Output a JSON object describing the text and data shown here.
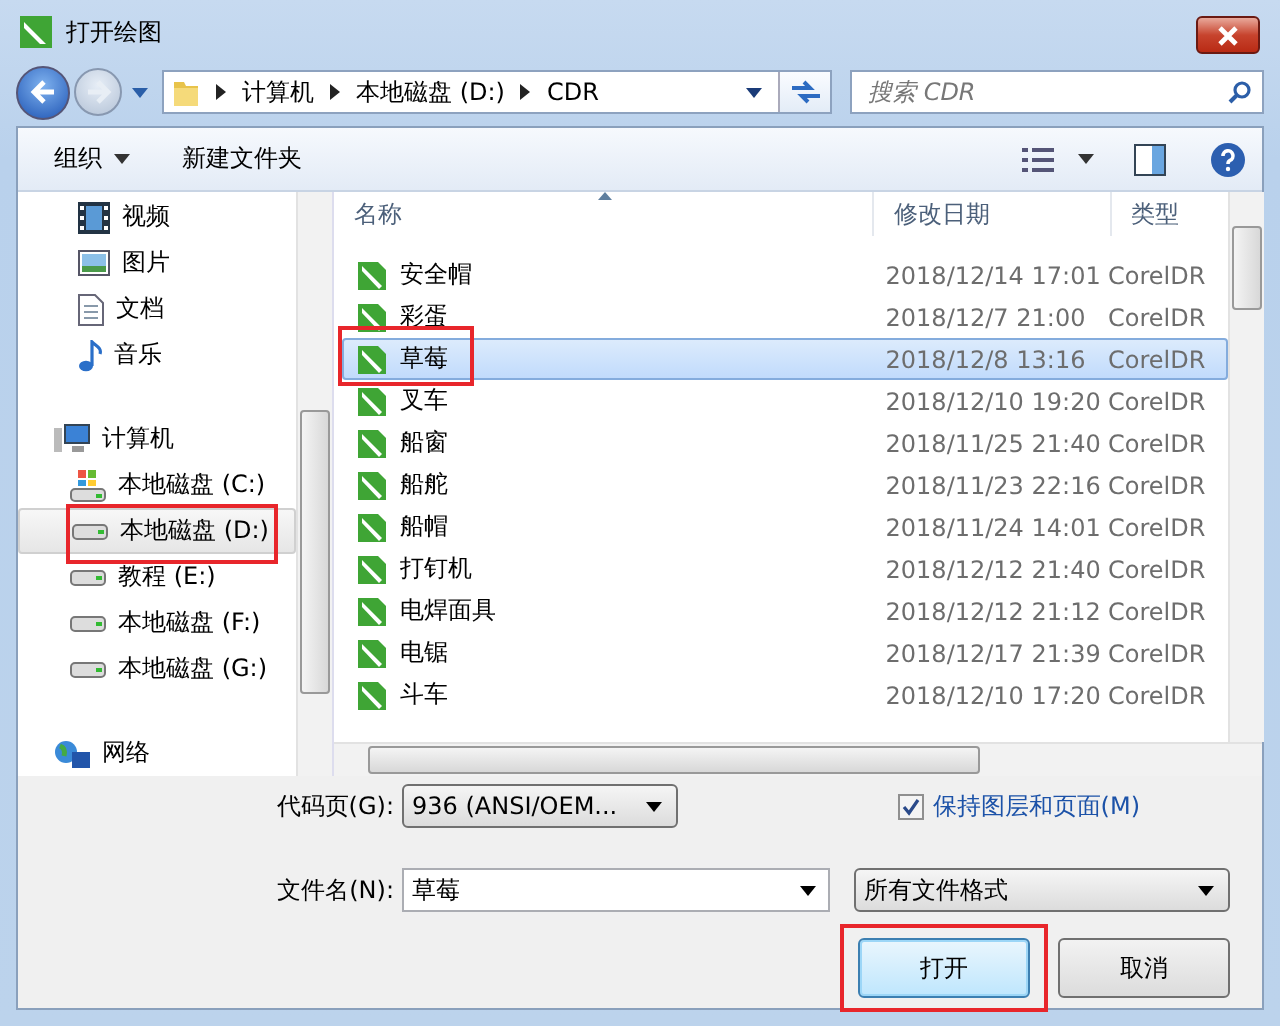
{
  "window": {
    "title": "打开绘图"
  },
  "address": {
    "path": [
      "计算机",
      "本地磁盘 (D:)",
      "CDR"
    ]
  },
  "search": {
    "placeholder": "搜索 CDR"
  },
  "toolbar": {
    "organize": "组织",
    "new_folder": "新建文件夹"
  },
  "sidebar": {
    "items": [
      {
        "label": "视频",
        "kind": "video",
        "selected": false,
        "highlighted": false
      },
      {
        "label": "图片",
        "kind": "pictures",
        "selected": false,
        "highlighted": false
      },
      {
        "label": "文档",
        "kind": "document",
        "selected": false,
        "highlighted": false
      },
      {
        "label": "音乐",
        "kind": "music",
        "selected": false,
        "highlighted": false
      },
      {
        "label": "计算机",
        "kind": "computer",
        "selected": false,
        "highlighted": false,
        "children": [
          {
            "label": "本地磁盘 (C:)",
            "kind": "system-drive",
            "selected": false,
            "highlighted": false
          },
          {
            "label": "本地磁盘 (D:)",
            "kind": "drive",
            "selected": true,
            "highlighted": true
          },
          {
            "label": "教程 (E:)",
            "kind": "drive",
            "selected": false,
            "highlighted": false
          },
          {
            "label": "本地磁盘 (F:)",
            "kind": "drive",
            "selected": false,
            "highlighted": false
          },
          {
            "label": "本地磁盘 (G:)",
            "kind": "drive",
            "selected": false,
            "highlighted": false
          }
        ]
      },
      {
        "label": "网络",
        "kind": "network",
        "selected": false,
        "highlighted": false
      }
    ]
  },
  "table": {
    "columns": [
      "名称",
      "修改日期",
      "类型"
    ],
    "rows": [
      {
        "name": "安全帽",
        "date": "2018/12/14 17:01",
        "type": "CorelDR",
        "selected": false,
        "highlighted": false
      },
      {
        "name": "彩蛋",
        "date": "2018/12/7 21:00",
        "type": "CorelDR",
        "selected": false,
        "highlighted": false
      },
      {
        "name": "草莓",
        "date": "2018/12/8 13:16",
        "type": "CorelDR",
        "selected": true,
        "highlighted": true
      },
      {
        "name": "叉车",
        "date": "2018/12/10 19:20",
        "type": "CorelDR",
        "selected": false,
        "highlighted": false
      },
      {
        "name": "船窗",
        "date": "2018/11/25 21:40",
        "type": "CorelDR",
        "selected": false,
        "highlighted": false
      },
      {
        "name": "船舵",
        "date": "2018/11/23 22:16",
        "type": "CorelDR",
        "selected": false,
        "highlighted": false
      },
      {
        "name": "船帽",
        "date": "2018/11/24 14:01",
        "type": "CorelDR",
        "selected": false,
        "highlighted": false
      },
      {
        "name": "打钉机",
        "date": "2018/12/12 21:40",
        "type": "CorelDR",
        "selected": false,
        "highlighted": false
      },
      {
        "name": "电焊面具",
        "date": "2018/12/12 21:12",
        "type": "CorelDR",
        "selected": false,
        "highlighted": false
      },
      {
        "name": "电锯",
        "date": "2018/12/17 21:39",
        "type": "CorelDR",
        "selected": false,
        "highlighted": false
      },
      {
        "name": "斗车",
        "date": "2018/12/10 17:20",
        "type": "CorelDR",
        "selected": false,
        "highlighted": false
      }
    ]
  },
  "options": {
    "encoding_label": "代码页(G):",
    "encoding": "936 (ANSI/OEM...",
    "keep_layers": {
      "label": "保持图层和页面(M)",
      "checked": true
    }
  },
  "filename": {
    "label": "文件名(N):",
    "value": "草莓"
  },
  "filetype": {
    "value": "所有文件格式"
  },
  "buttons": [
    {
      "label": "打开",
      "default": true,
      "highlighted": true
    },
    {
      "label": "取消",
      "default": false,
      "highlighted": false
    }
  ]
}
